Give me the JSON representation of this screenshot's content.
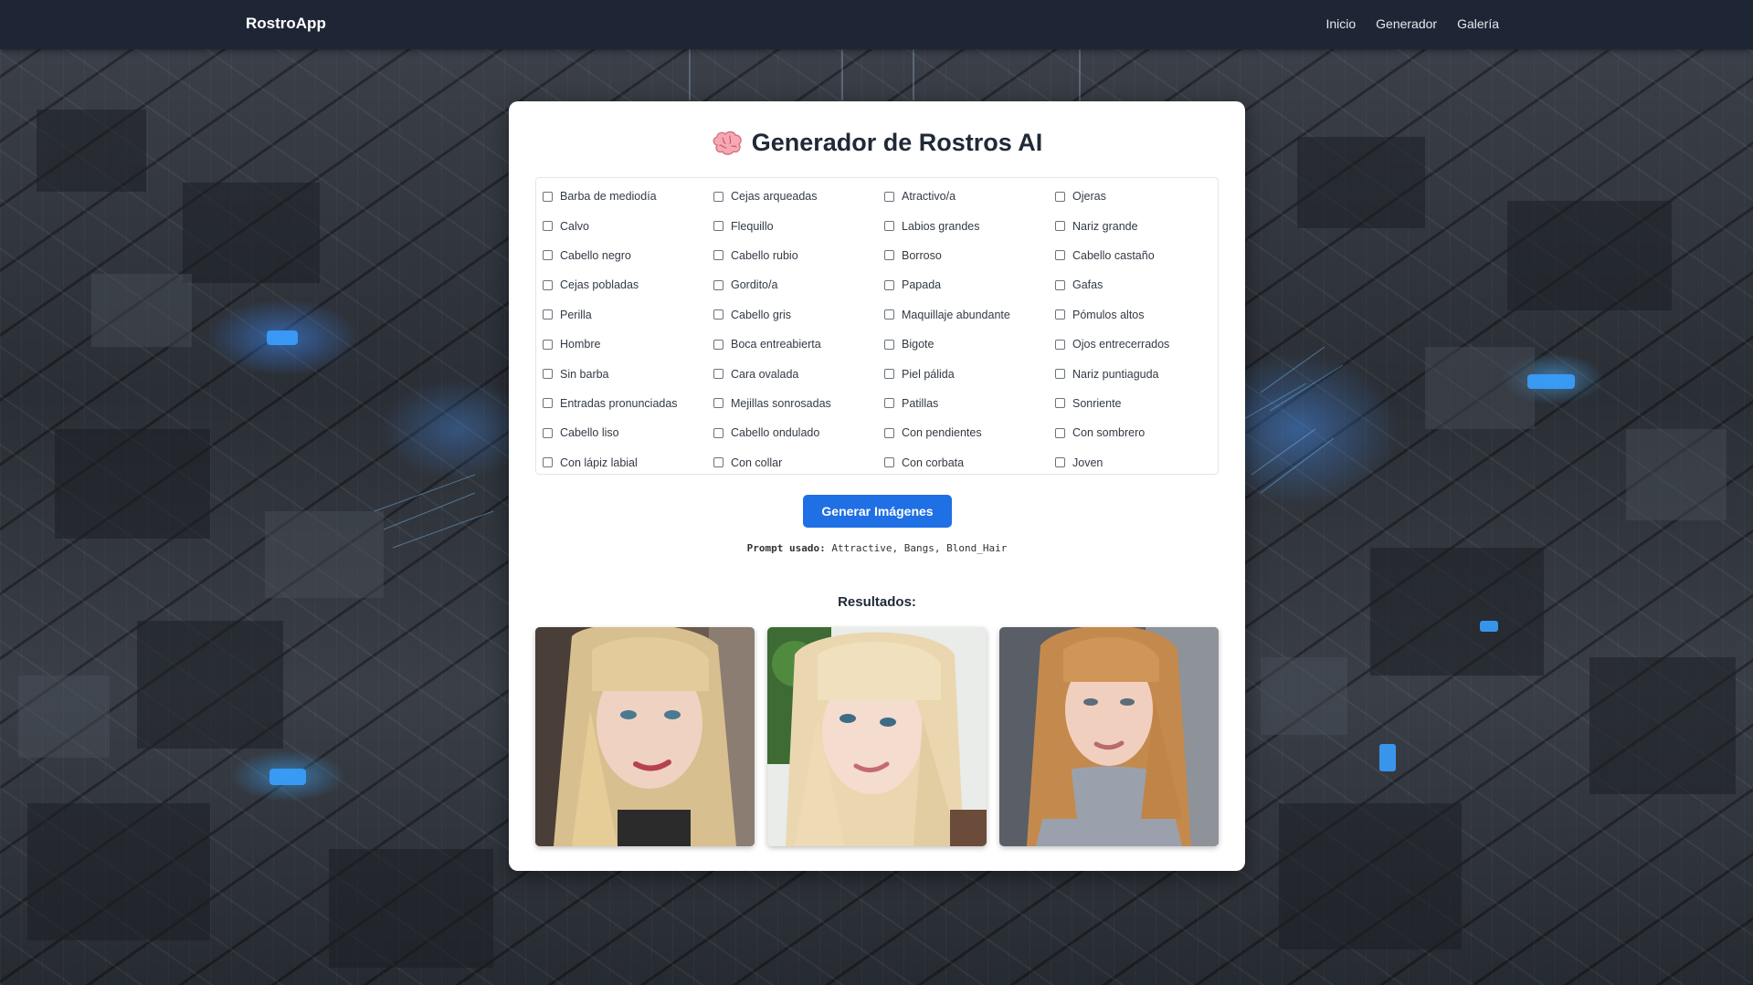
{
  "navbar": {
    "brand": "RostroApp",
    "links": [
      "Inicio",
      "Generador",
      "Galería"
    ]
  },
  "page": {
    "title": "Generador de Rostros AI",
    "title_icon": "brain-icon"
  },
  "options": [
    "Barba de mediodía",
    "Cejas arqueadas",
    "Atractivo/a",
    "Ojeras",
    "Calvo",
    "Flequillo",
    "Labios grandes",
    "Nariz grande",
    "Cabello negro",
    "Cabello rubio",
    "Borroso",
    "Cabello castaño",
    "Cejas pobladas",
    "Gordito/a",
    "Papada",
    "Gafas",
    "Perilla",
    "Cabello gris",
    "Maquillaje abundante",
    "Pómulos altos",
    "Hombre",
    "Boca entreabierta",
    "Bigote",
    "Ojos entrecerrados",
    "Sin barba",
    "Cara ovalada",
    "Piel pálida",
    "Nariz puntiaguda",
    "Entradas pronunciadas",
    "Mejillas sonrosadas",
    "Patillas",
    "Sonriente",
    "Cabello liso",
    "Cabello ondulado",
    "Con pendientes",
    "Con sombrero",
    "Con lápiz labial",
    "Con collar",
    "Con corbata",
    "Joven"
  ],
  "generate_button": "Generar Imágenes",
  "prompt": {
    "label": "Prompt usado:",
    "value": "Attractive, Bangs, Blond_Hair"
  },
  "results": {
    "title": "Resultados:"
  },
  "colors": {
    "navbar": "#1e2636",
    "button": "#1f6fe5"
  }
}
